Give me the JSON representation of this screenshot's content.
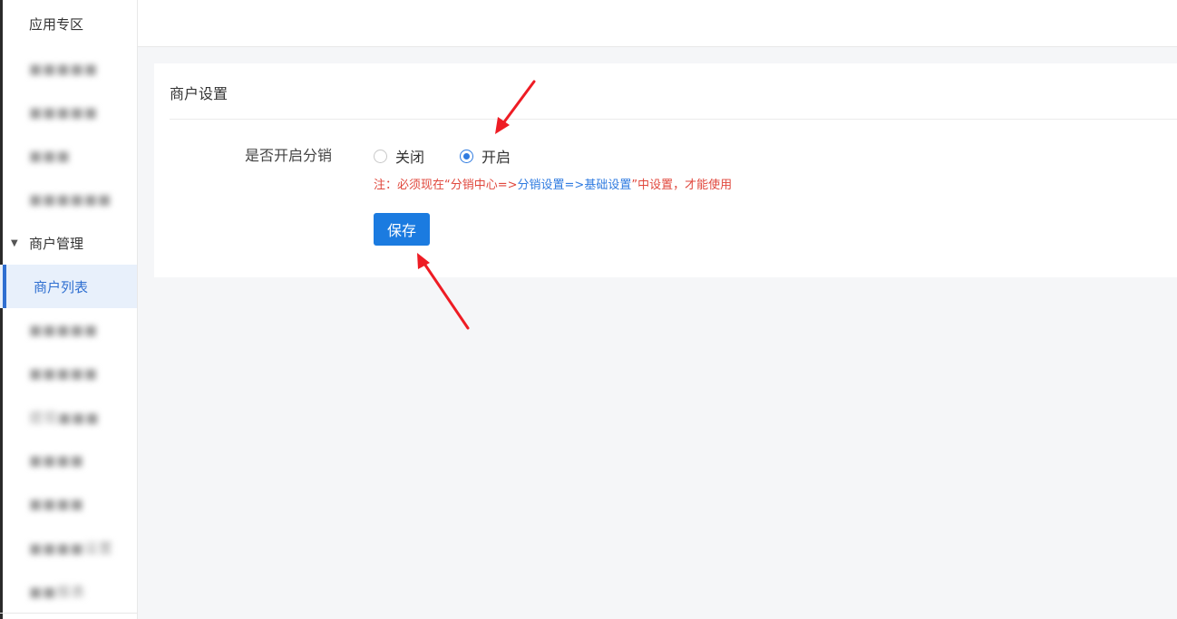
{
  "sidebar": {
    "title": "应用专区",
    "items": [
      {
        "label": "■■■■■"
      },
      {
        "label": "■■■■■"
      },
      {
        "label": "■■■"
      },
      {
        "label": "■■■■■■"
      },
      {
        "label": "商户管理"
      },
      {
        "label": "商户列表"
      },
      {
        "label": "■■■■■"
      },
      {
        "label": "■■■■■"
      },
      {
        "label": "提现■■■"
      },
      {
        "label": "■■■■"
      },
      {
        "label": "■■■■"
      },
      {
        "label": "■■■■设置"
      },
      {
        "label": "■■报表"
      }
    ]
  },
  "panel": {
    "title": "商户设置",
    "field_label": "是否开启分销",
    "options": [
      {
        "label": "关闭",
        "checked": false
      },
      {
        "label": "开启",
        "checked": true
      }
    ],
    "note_prefix": "注：必须现在“分销中心=>",
    "note_link": "分销设置=>基础设置",
    "note_suffix": "”中设置，才能使用",
    "save_label": "保存"
  },
  "colors": {
    "accent": "#1b7be0",
    "note_red": "#e0473c",
    "active_bg": "#e8f0fb",
    "arrow": "#ee1c24"
  }
}
